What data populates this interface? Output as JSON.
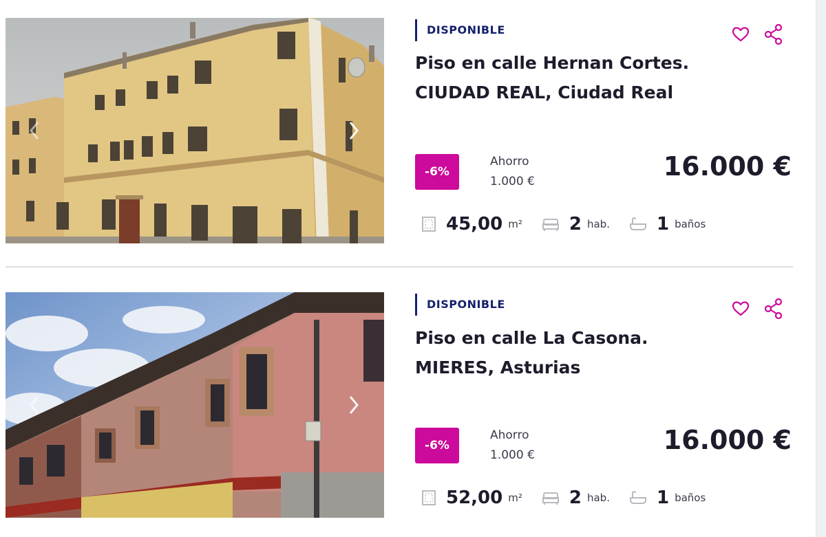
{
  "listings": [
    {
      "status": "DISPONIBLE",
      "title_line1": "Piso en calle Hernan Cortes.",
      "title_line2": "CIUDAD REAL, Ciudad Real",
      "discount": "-6%",
      "saving_label": "Ahorro",
      "saving_amount": "1.000 €",
      "price": "16.000 €",
      "area_value": "45,00",
      "area_unit": "m²",
      "rooms_value": "2",
      "rooms_unit": "hab.",
      "baths_value": "1",
      "baths_unit": "baños"
    },
    {
      "status": "DISPONIBLE",
      "title_line1": "Piso en calle La Casona.",
      "title_line2": "MIERES, Asturias",
      "discount": "-6%",
      "saving_label": "Ahorro",
      "saving_amount": "1.000 €",
      "price": "16.000 €",
      "area_value": "52,00",
      "area_unit": "m²",
      "rooms_value": "2",
      "rooms_unit": "hab.",
      "baths_value": "1",
      "baths_unit": "baños"
    }
  ],
  "icons": {
    "favorite": "heart-outline-icon",
    "share": "share-icon",
    "area": "floor-area-icon",
    "rooms": "bed-icon",
    "baths": "bathtub-icon",
    "prev": "chevron-left-icon",
    "next": "chevron-right-icon"
  },
  "colors": {
    "accent": "#cc0a9b",
    "status": "#14216b",
    "text": "#1c1c2b"
  }
}
